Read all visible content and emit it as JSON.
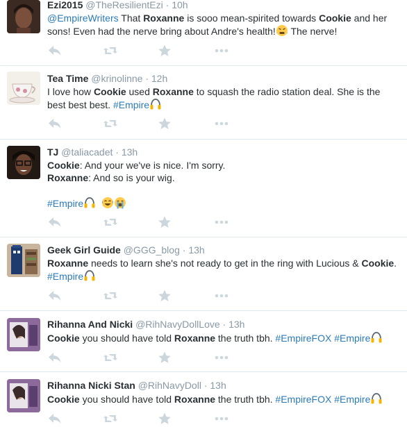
{
  "tweets": [
    {
      "name": "Ezi2015",
      "handle": "@TheResilientEzi",
      "sep": "·",
      "time": "10h",
      "mention": "@EmpireWriters",
      "t1": "That",
      "b1": "Roxanne",
      "t2": "is sooo mean-spirited towards",
      "b2": "Cookie",
      "t3": "and her sons! Even had the nerve bring about Andre's health!",
      "t4": "The nerve!"
    },
    {
      "name": "Tea Time",
      "handle": "@krinolinne",
      "sep": "·",
      "time": "12h",
      "t1": "I love how",
      "b1": "Cookie",
      "t2": "used",
      "b2": "Roxanne",
      "t3": "to squash the radio station deal. She is the best best best.",
      "tag": "#Empire"
    },
    {
      "name": "TJ",
      "handle": "@taliacadet",
      "sep": "·",
      "time": "13h",
      "b1": "Cookie",
      "t1": ": And your we've is nice. I'm sorry.",
      "b2": "Roxanne",
      "t2": ": And so is your wig.",
      "tag": "#Empire"
    },
    {
      "name": "Geek Girl Guide",
      "handle": "@GGG_blog",
      "sep": "·",
      "time": "13h",
      "b1": "Roxanne",
      "t1": "needs to learn she's not ready to get in the ring with Lucious &",
      "b2": "Cookie",
      "t2": ".",
      "tag": "#Empire"
    },
    {
      "name": "Rihanna And Nicki",
      "handle": "@RihNavyDollLove",
      "sep": "·",
      "time": "13h",
      "b1": "Cookie",
      "t1": "you should have told",
      "b2": "Roxanne",
      "t2": "the truth tbh.",
      "tag1": "#EmpireFOX",
      "tag2": "#Empire"
    },
    {
      "name": "Rihanna Nicki Stan",
      "handle": "@RihNavyDoll",
      "sep": "·",
      "time": "13h",
      "b1": "Cookie",
      "t1": "you should have told",
      "b2": "Roxanne",
      "t2": "the truth tbh.",
      "tag1": "#EmpireFOX",
      "tag2": "#Empire"
    }
  ],
  "icons": {
    "reply": "reply-icon",
    "retweet": "retweet-icon",
    "favorite": "star-icon",
    "more": "more-icon",
    "headphones": "headphones-emoji",
    "frustrated": "frustrated-face-emoji",
    "joy": "tears-of-joy-emoji",
    "crying": "loudly-crying-emoji"
  },
  "colors": {
    "name": "#292f33",
    "meta": "#8899a6",
    "link": "#2b7bb9",
    "action_icon": "#ccd6dd",
    "divider": "#e1e8ed"
  }
}
